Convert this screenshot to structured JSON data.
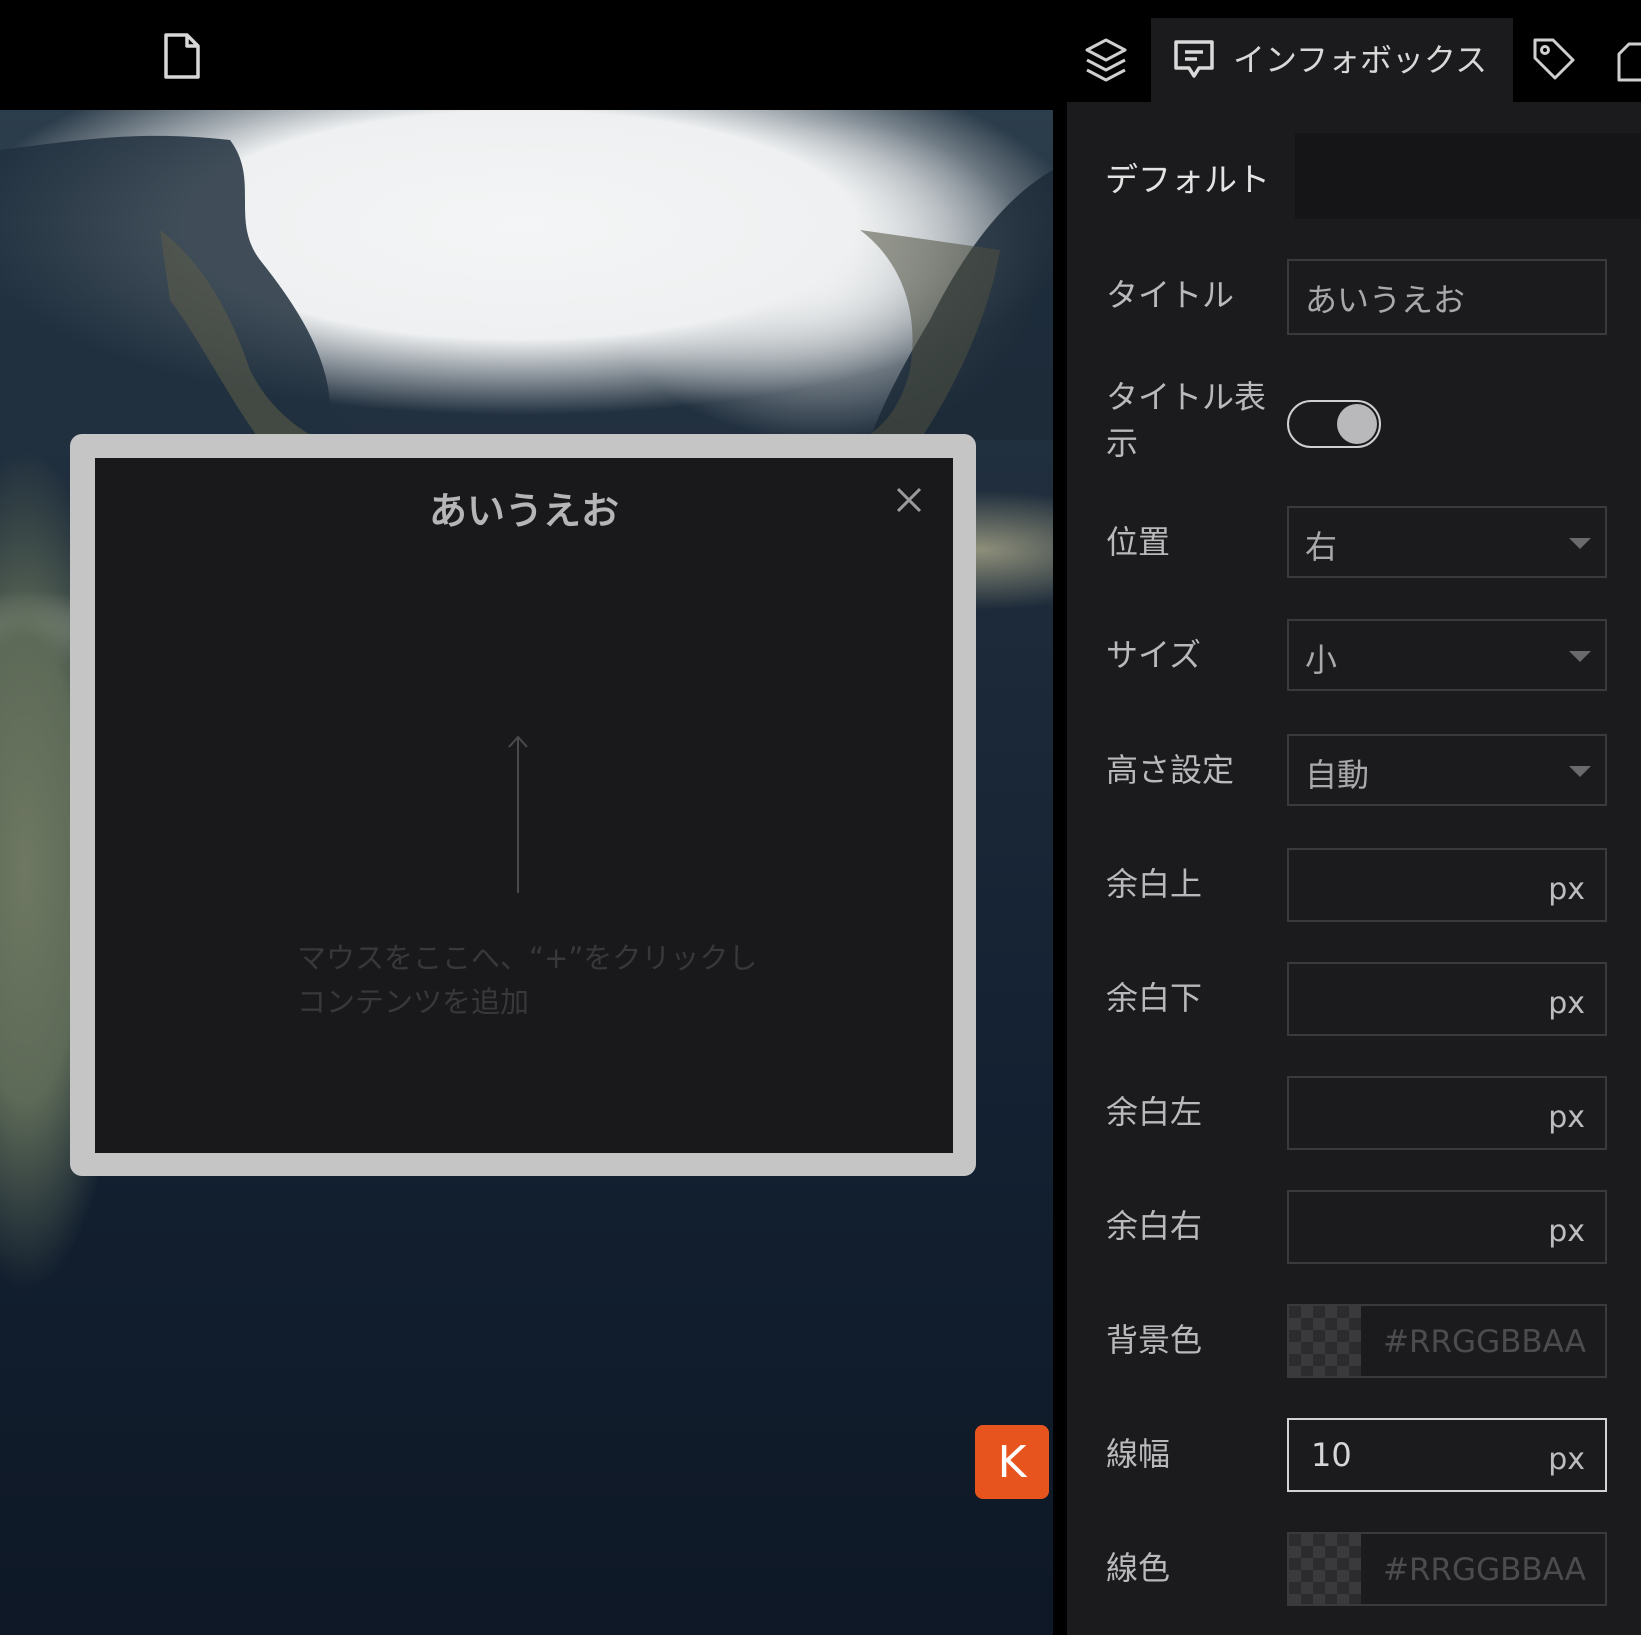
{
  "map": {
    "badge": "K"
  },
  "infobox": {
    "title": "あいうえお",
    "hint_line1": "マウスをここへ、“+”をクリックし",
    "hint_line2": "コンテンツを追加"
  },
  "tabs": {
    "active_label": "インフォボックス",
    "subtab": "デフォルト"
  },
  "form": {
    "title": {
      "label": "タイトル",
      "value": "あいうえお"
    },
    "title_display": {
      "label_line1": "タイトル表",
      "label_line2": "示",
      "on": true
    },
    "position": {
      "label": "位置",
      "value": "右"
    },
    "size": {
      "label": "サイズ",
      "value": "小"
    },
    "height": {
      "label": "高さ設定",
      "value": "自動"
    },
    "margin_top": {
      "label": "余白上",
      "unit": "px"
    },
    "margin_bottom": {
      "label": "余白下",
      "unit": "px"
    },
    "margin_left": {
      "label": "余白左",
      "unit": "px"
    },
    "margin_right": {
      "label": "余白右",
      "unit": "px"
    },
    "bg_color": {
      "label": "背景色",
      "placeholder": "#RRGGBBAA"
    },
    "line_width": {
      "label": "線幅",
      "value": "10",
      "unit": "px"
    },
    "line_color": {
      "label": "線色",
      "placeholder": "#RRGGBBAA"
    }
  }
}
